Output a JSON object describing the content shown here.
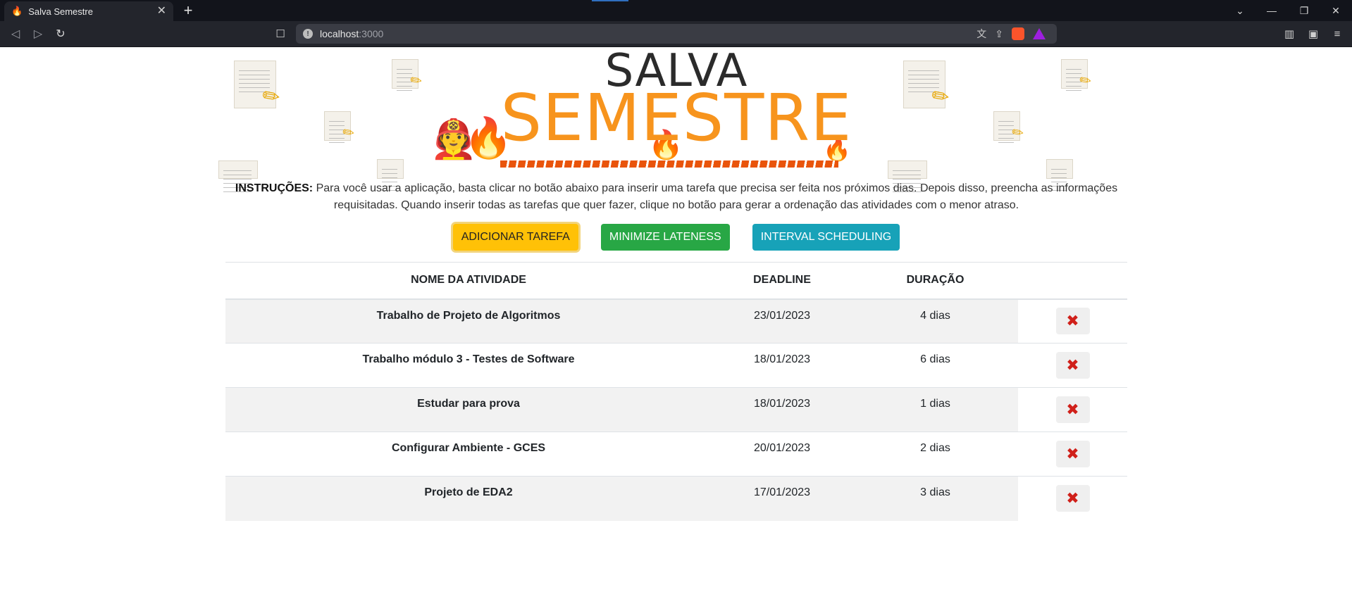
{
  "browser": {
    "tab_title": "Salva Semestre",
    "tab_icon": "fire-icon",
    "url_host": "localhost",
    "url_port": ":3000"
  },
  "header": {
    "logo_line1": "SALVA",
    "logo_line2": "SEMESTRE"
  },
  "instructions": {
    "label": "INSTRUÇÕES:",
    "text": "Para você usar a aplicação, basta clicar no botão abaixo para inserir uma tarefa que precisa ser feita nos próximos dias. Depois disso, preencha as informações requisitadas. Quando inserir todas as tarefas que quer fazer, clique no botão para gerar a ordenação das atividades com o menor atraso."
  },
  "buttons": {
    "add": "ADICIONAR TAREFA",
    "minimize": "MINIMIZE LATENESS",
    "interval": "INTERVAL SCHEDULING"
  },
  "table": {
    "headers": [
      "NOME DA ATIVIDADE",
      "DEADLINE",
      "DURAÇÃO",
      ""
    ],
    "rows": [
      {
        "name": "Trabalho de Projeto de Algoritmos",
        "deadline": "23/01/2023",
        "duration": "4 dias"
      },
      {
        "name": "Trabalho módulo 3 - Testes de Software",
        "deadline": "18/01/2023",
        "duration": "6 dias"
      },
      {
        "name": "Estudar para prova",
        "deadline": "18/01/2023",
        "duration": "1 dias"
      },
      {
        "name": "Configurar Ambiente - GCES",
        "deadline": "20/01/2023",
        "duration": "2 dias"
      },
      {
        "name": "Projeto de EDA2",
        "deadline": "17/01/2023",
        "duration": "3 dias"
      }
    ]
  },
  "colors": {
    "brand_orange": "#f7941d",
    "warning": "#ffc107",
    "success": "#28a745",
    "info": "#17a2b8",
    "delete": "#d0201a"
  }
}
